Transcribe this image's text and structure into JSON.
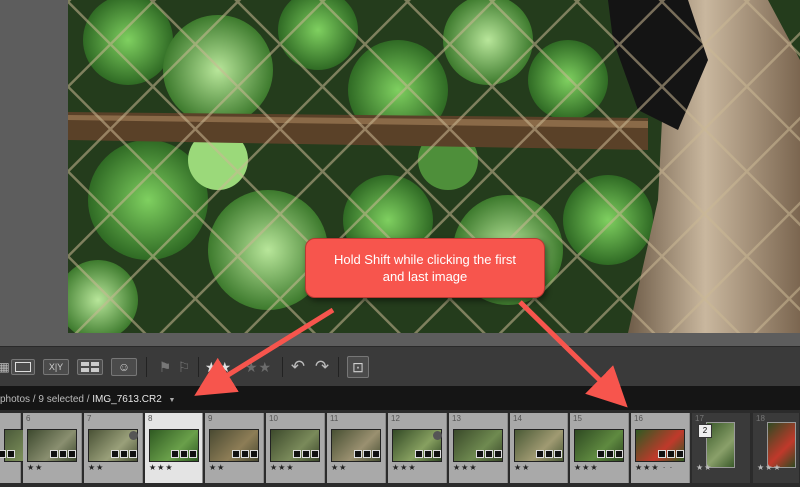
{
  "callout": {
    "text": "Hold Shift while clicking the first and last image"
  },
  "toolbar": {
    "grid_view": "▦",
    "loupe_view": "",
    "compare_view": "X|Y",
    "survey_view": "▤",
    "people_view": "☺",
    "flag_pick": "⚑",
    "flag_reject": "⚐",
    "rating_filled": "★★",
    "rating_empty": "★★",
    "rotate_left": "↶",
    "rotate_right": "↷",
    "crop_overlay": "⊡"
  },
  "filmstrip_header": {
    "path": "photos / 9 selected / ",
    "filename": "IMG_7613.CR2",
    "dropdown_icon": "▼"
  },
  "filmstrip": {
    "cells": [
      {
        "num": "",
        "stars": "",
        "style": "normal"
      },
      {
        "num": "6",
        "stars": "★★",
        "style": "normal"
      },
      {
        "num": "7",
        "stars": "★★",
        "style": "normal"
      },
      {
        "num": "8",
        "stars": "★★★",
        "style": "active"
      },
      {
        "num": "9",
        "stars": "★★",
        "style": "normal"
      },
      {
        "num": "10",
        "stars": "★★★",
        "style": "normal"
      },
      {
        "num": "11",
        "stars": "★★",
        "style": "normal"
      },
      {
        "num": "12",
        "stars": "★★★",
        "style": "normal"
      },
      {
        "num": "13",
        "stars": "★★★",
        "style": "normal"
      },
      {
        "num": "14",
        "stars": "★★",
        "style": "normal"
      },
      {
        "num": "15",
        "stars": "★★★",
        "style": "normal"
      },
      {
        "num": "16",
        "stars": "★★★ · ·",
        "style": "normal"
      },
      {
        "num": "17",
        "stars": "★★",
        "style": "dark",
        "stack": "2"
      },
      {
        "num": "18",
        "stars": "★★★",
        "style": "dark"
      }
    ]
  },
  "colors": {
    "callout": "#f7554d",
    "arrow": "#f7554d",
    "panel": "#5d5d5d",
    "toolbar": "#3a3a3a"
  }
}
